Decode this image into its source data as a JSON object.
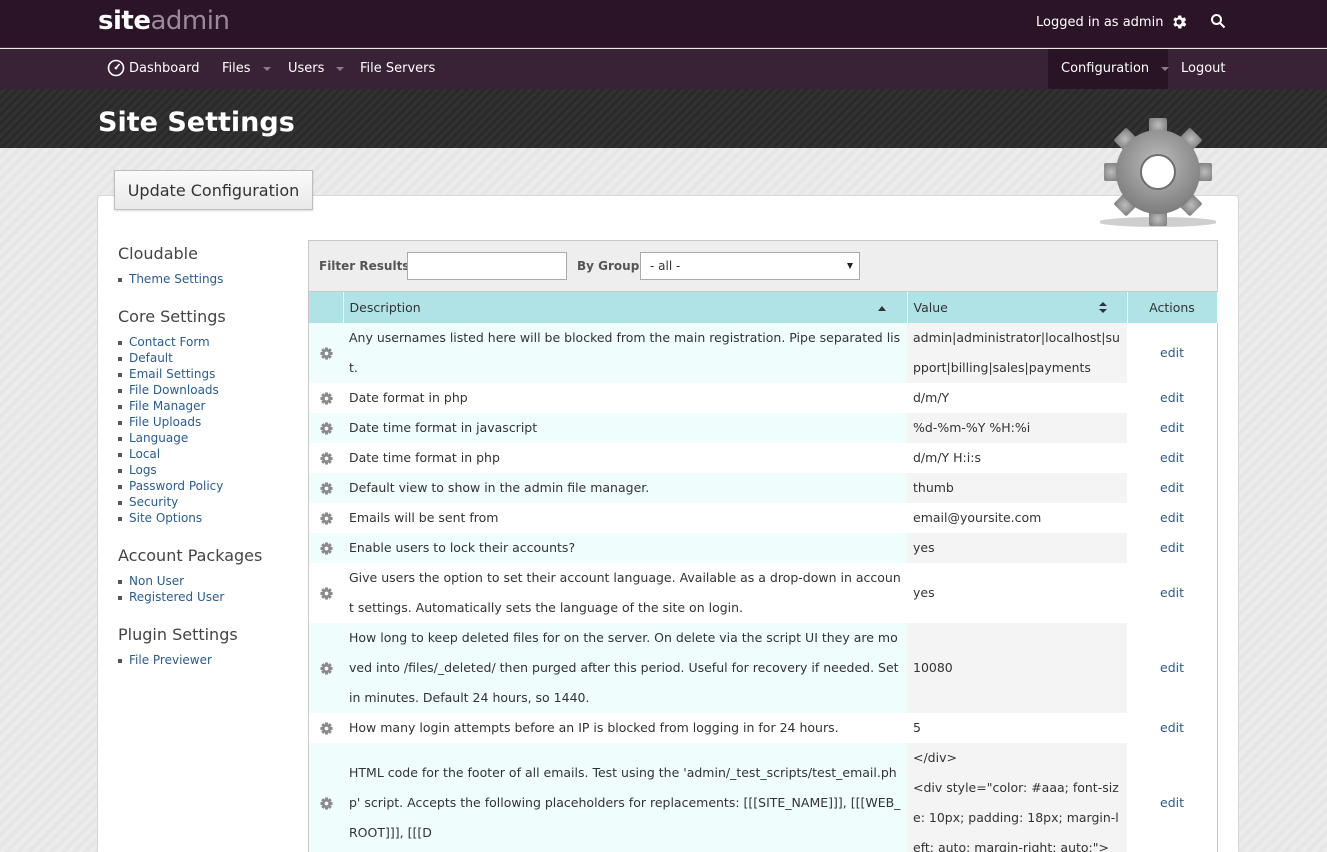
{
  "brand": {
    "part1": "site",
    "part2": "admin"
  },
  "topbar": {
    "logged_in": "Logged in as admin"
  },
  "nav": {
    "dashboard": "Dashboard",
    "files": "Files",
    "users": "Users",
    "file_servers": "File Servers",
    "configuration": "Configuration",
    "logout": "Logout"
  },
  "page": {
    "title": "Site Settings",
    "update_button": "Update Configuration"
  },
  "sidebar": {
    "groups": [
      {
        "title": "Cloudable",
        "items": [
          "Theme Settings"
        ]
      },
      {
        "title": "Core Settings",
        "items": [
          "Contact Form",
          "Default",
          "Email Settings",
          "File Downloads",
          "File Manager",
          "File Uploads",
          "Language",
          "Local",
          "Logs",
          "Password Policy",
          "Security",
          "Site Options"
        ]
      },
      {
        "title": "Account Packages",
        "items": [
          "Non User",
          "Registered User"
        ]
      },
      {
        "title": "Plugin Settings",
        "items": [
          "File Previewer"
        ]
      }
    ]
  },
  "filter": {
    "label": "Filter Results:",
    "value": "",
    "group_label": "By Group:",
    "group_value": "- all -"
  },
  "table": {
    "headers": {
      "description": "Description",
      "value": "Value",
      "actions": "Actions"
    },
    "rows": [
      {
        "description": "Any usernames listed here will be blocked from the main registration. Pipe separated list.",
        "value": "admin|administrator|localhost|support|billing|sales|payments",
        "action": "edit"
      },
      {
        "description": "Date format in php",
        "value": "d/m/Y",
        "action": "edit"
      },
      {
        "description": "Date time format in javascript",
        "value": "%d-%m-%Y %H:%i",
        "action": "edit"
      },
      {
        "description": "Date time format in php",
        "value": "d/m/Y H:i:s",
        "action": "edit"
      },
      {
        "description": "Default view to show in the admin file manager.",
        "value": "thumb",
        "action": "edit"
      },
      {
        "description": "Emails will be sent from",
        "value": "email@yoursite.com",
        "action": "edit"
      },
      {
        "description": "Enable users to lock their accounts?",
        "value": "yes",
        "action": "edit"
      },
      {
        "description": "Give users the option to set their account language. Available as a drop-down in account settings. Automatically sets the language of the site on login.",
        "value": "yes",
        "action": "edit"
      },
      {
        "description": "How long to keep deleted files for on the server. On delete via the script UI they are moved into /files/_deleted/ then purged after this period. Useful for recovery if needed. Set in minutes. Default 24 hours, so 1440.",
        "value": "10080",
        "action": "edit"
      },
      {
        "description": "How many login attempts before an IP is blocked from logging in for 24 hours.",
        "value": "5",
        "action": "edit"
      },
      {
        "description": "HTML code for the footer of all emails. Test using the 'admin/_test_scripts/test_email.php' script. Accepts the following placeholders for replacements: [[[SITE_NAME]]], [[[WEB_ROOT]]], [[[D",
        "value_lines": [
          "</div>",
          "<div style=\"color: #aaa; font-size: 10px; padding: 18px; margin-left: auto; margin-right: auto;\">"
        ],
        "action": "edit"
      }
    ]
  }
}
